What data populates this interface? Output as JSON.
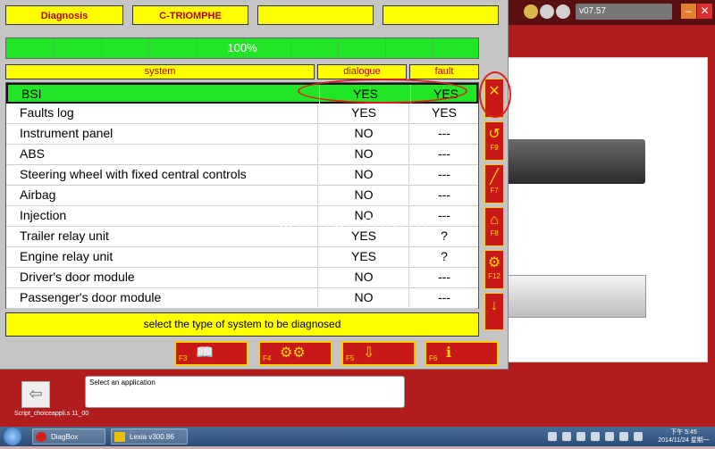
{
  "header": {
    "diagnosis": "Diagnosis",
    "vehicle": "C-TRIOMPHE",
    "blank1": "",
    "blank2": ""
  },
  "progress": {
    "label": "100%",
    "value": 100
  },
  "columns": {
    "system": "system",
    "dialogue": "dialogue",
    "fault": "fault"
  },
  "rows": [
    {
      "system": "BSI",
      "dialogue": "YES",
      "fault": "YES"
    },
    {
      "system": "Faults log",
      "dialogue": "YES",
      "fault": "YES"
    },
    {
      "system": "Instrument panel",
      "dialogue": "NO",
      "fault": "---"
    },
    {
      "system": "ABS",
      "dialogue": "NO",
      "fault": "---"
    },
    {
      "system": "Steering wheel with fixed central controls",
      "dialogue": "NO",
      "fault": "---"
    },
    {
      "system": "Airbag",
      "dialogue": "NO",
      "fault": "---"
    },
    {
      "system": "Injection",
      "dialogue": "NO",
      "fault": "---"
    },
    {
      "system": "Trailer relay unit",
      "dialogue": "YES",
      "fault": "?"
    },
    {
      "system": "Engine relay unit",
      "dialogue": "YES",
      "fault": "?"
    },
    {
      "system": "Driver's door module",
      "dialogue": "NO",
      "fault": "---"
    },
    {
      "system": "Passenger's door module",
      "dialogue": "NO",
      "fault": "---"
    }
  ],
  "status_text": "select the type of system to be diagnosed",
  "side_buttons": [
    {
      "key": "",
      "icon": "tools-icon"
    },
    {
      "key": "F9",
      "icon": "undo-icon"
    },
    {
      "key": "F7",
      "icon": "wrench-icon"
    },
    {
      "key": "F8",
      "icon": "car-lift-icon"
    },
    {
      "key": "F12",
      "icon": "gear-signal-icon"
    },
    {
      "key": "",
      "icon": "arrow-down-icon"
    }
  ],
  "function_buttons": [
    {
      "key": "F3",
      "icon": "book-car-icon"
    },
    {
      "key": "F4",
      "icon": "gears-icon"
    },
    {
      "key": "F5",
      "icon": "flowchart-icon"
    },
    {
      "key": "F6",
      "icon": "info-icon"
    }
  ],
  "app": {
    "version": "v07.57",
    "message_box": "Select an application",
    "script_label": "Script_choiceappli.s   11_00"
  },
  "taskbar": {
    "items": [
      "DiagBox",
      "Lexia v300.86"
    ],
    "time": "下午 5:45",
    "date": "2014/11/24 星期一"
  },
  "watermark": "Store No. 208267",
  "colors": {
    "accent_red": "#c81818",
    "yellow": "#ffff00",
    "green": "#21e626"
  }
}
